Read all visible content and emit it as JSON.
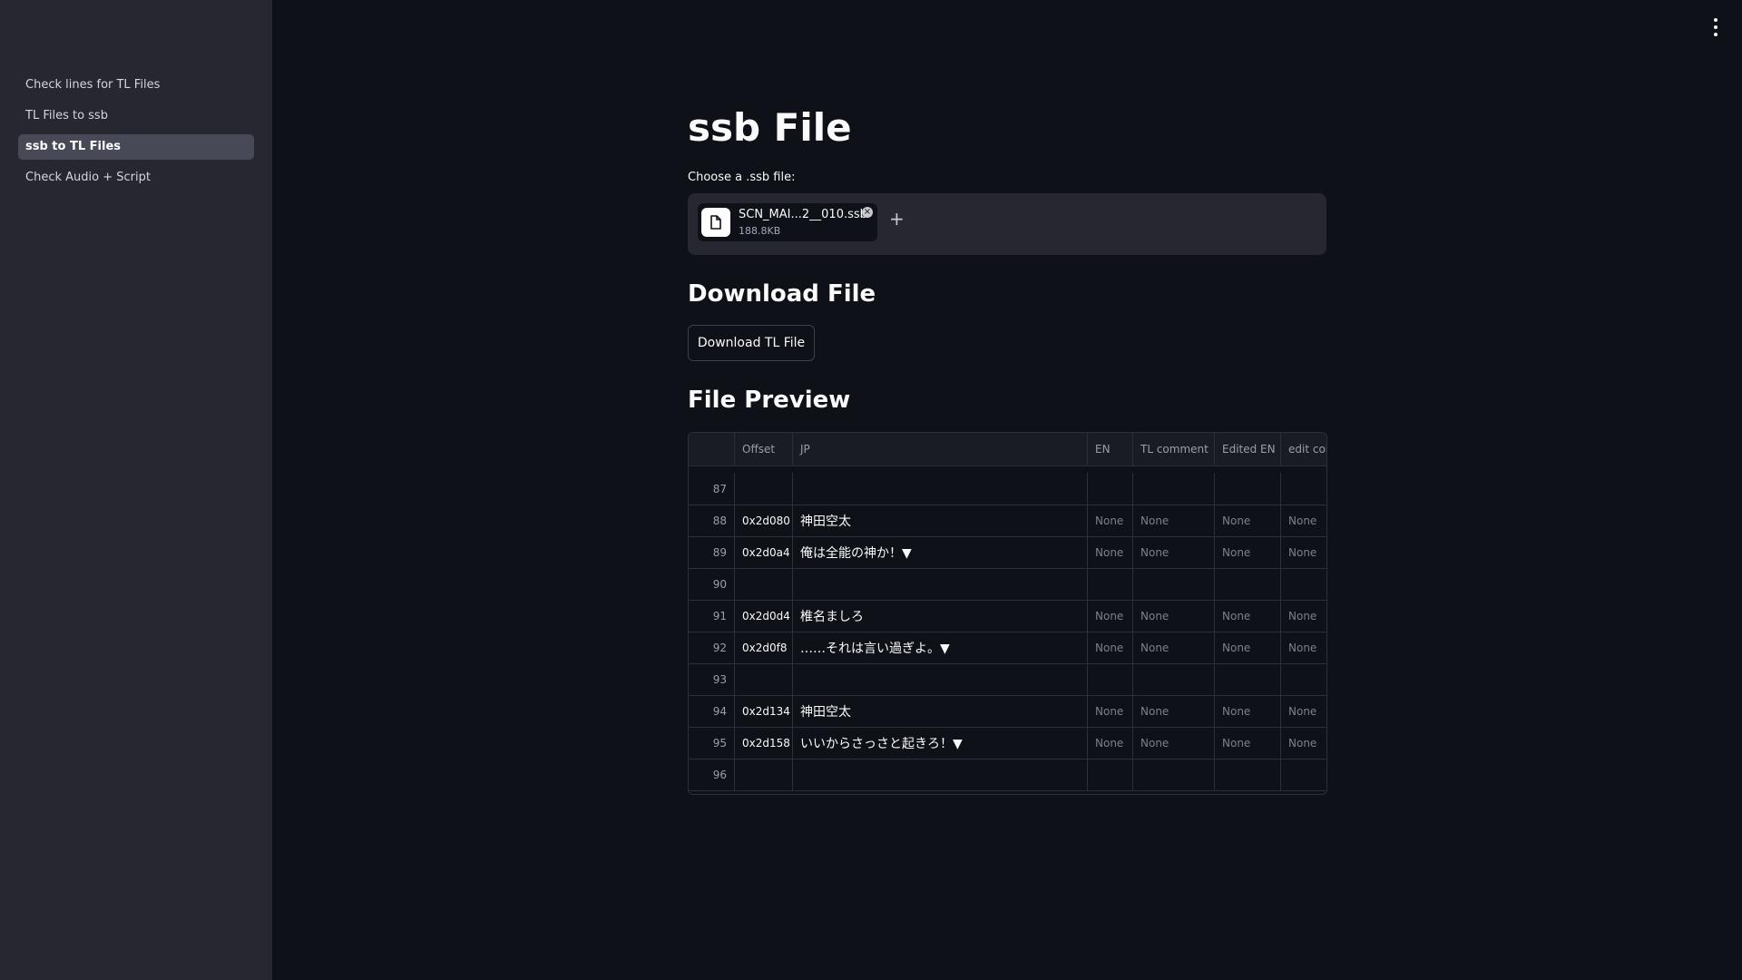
{
  "sidebar": {
    "items": [
      {
        "label": "Check lines for TL Files",
        "active": false
      },
      {
        "label": "TL Files to ssb",
        "active": false
      },
      {
        "label": "ssb to TL Files",
        "active": true
      },
      {
        "label": "Check Audio + Script",
        "active": false
      }
    ]
  },
  "main": {
    "title": "ssb File",
    "uploader": {
      "label": "Choose a .ssb file:",
      "file_name": "SCN_MAI...2__010.ssb",
      "file_size": "188.8KB"
    },
    "download_heading": "Download File",
    "download_button": "Download TL File",
    "preview_heading": "File Preview",
    "table": {
      "columns": [
        "",
        "Offset",
        "JP",
        "EN",
        "TL comment",
        "Edited EN",
        "edit cor"
      ],
      "rows": [
        [
          "87",
          "",
          "",
          "",
          "",
          "",
          ""
        ],
        [
          "88",
          "0x2d080",
          "神田空太",
          "None",
          "None",
          "None",
          "None"
        ],
        [
          "89",
          "0x2d0a4",
          "俺は全能の神か！▼",
          "None",
          "None",
          "None",
          "None"
        ],
        [
          "90",
          "",
          "",
          "",
          "",
          "",
          ""
        ],
        [
          "91",
          "0x2d0d4",
          "椎名ましろ",
          "None",
          "None",
          "None",
          "None"
        ],
        [
          "92",
          "0x2d0f8",
          "……それは言い過ぎよ。▼",
          "None",
          "None",
          "None",
          "None"
        ],
        [
          "93",
          "",
          "",
          "",
          "",
          "",
          ""
        ],
        [
          "94",
          "0x2d134",
          "神田空太",
          "None",
          "None",
          "None",
          "None"
        ],
        [
          "95",
          "0x2d158",
          "いいからさっさと起きろ！▼",
          "None",
          "None",
          "None",
          "None"
        ],
        [
          "96",
          "",
          "",
          "",
          "",
          "",
          ""
        ]
      ]
    }
  },
  "icons": {
    "menu": "vertical-dots-icon",
    "file": "file-icon",
    "remove": "close-icon",
    "add": "plus-icon"
  },
  "colors": {
    "background": "#0e1117",
    "sidebar": "#262730",
    "text": "#fafafa"
  }
}
